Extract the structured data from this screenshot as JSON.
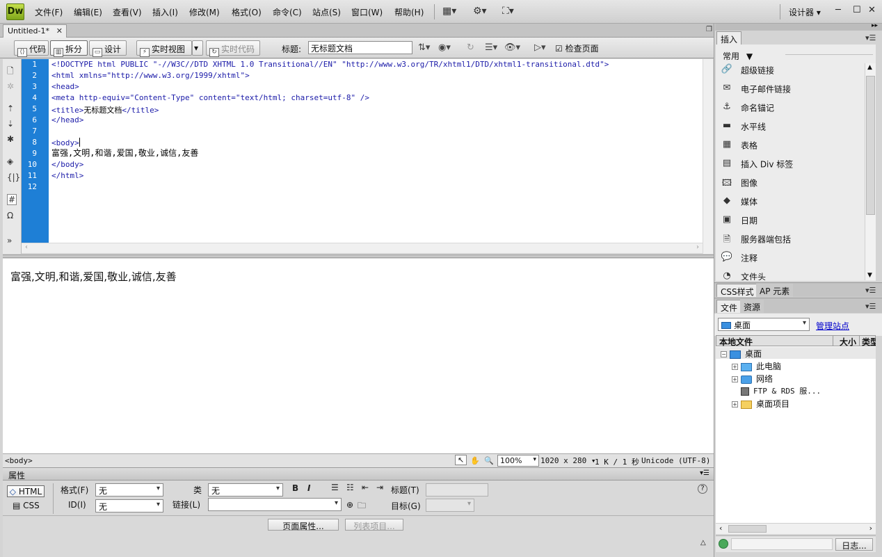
{
  "app": {
    "logo": "Dw",
    "menus": [
      "文件(F)",
      "编辑(E)",
      "查看(V)",
      "插入(I)",
      "修改(M)",
      "格式(O)",
      "命令(C)",
      "站点(S)",
      "窗口(W)",
      "帮助(H)"
    ],
    "workspace": "设计器"
  },
  "document": {
    "tab_name": "Untitled-1*",
    "toolbar": {
      "code": "代码",
      "split": "拆分",
      "design": "设计",
      "live_view": "实时视图",
      "live_code": "实时代码",
      "title_label": "标题:",
      "title_value": "无标题文档",
      "check_page": "检查页面"
    }
  },
  "code": {
    "line_numbers": [
      "1",
      "2",
      "3",
      "4",
      "5",
      "6",
      "7",
      "8",
      "9",
      "10",
      "11",
      "12"
    ],
    "lines": [
      "<!DOCTYPE html PUBLIC \"-//W3C//DTD XHTML 1.0 Transitional//EN\" \"http://www.w3.org/TR/xhtml1/DTD/xhtml1-transitional.dtd\">",
      "<html xmlns=\"http://www.w3.org/1999/xhtml\">",
      "<head>",
      "<meta http-equiv=\"Content-Type\" content=\"text/html; charset=utf-8\" />",
      "<title>",
      "</head>",
      "",
      "<body>",
      "",
      "</body>",
      "</html>",
      ""
    ],
    "title_text": "无标题文档",
    "title_close": "</title>",
    "body_text": "富强,文明,和谐,爱国,敬业,诚信,友善"
  },
  "design": {
    "text": "富强,文明,和谐,爱国,敬业,诚信,友善"
  },
  "status": {
    "tag": "<body>",
    "zoom": "100%",
    "dimensions": "1020 x 280",
    "size_info": "1 K / 1 秒",
    "encoding": "Unicode (UTF-8)"
  },
  "properties": {
    "title": "属性",
    "html_btn": "HTML",
    "css_btn": "CSS",
    "format_label": "格式(F)",
    "format_value": "无",
    "class_label": "类",
    "class_value": "无",
    "id_label": "ID(I)",
    "id_value": "无",
    "link_label": "链接(L)",
    "link_value": "",
    "title_label": "标题(T)",
    "target_label": "目标(G)",
    "bold": "B",
    "italic": "I",
    "page_props_btn": "页面属性...",
    "list_item_btn": "列表项目...",
    "help": "?"
  },
  "insert_panel": {
    "tab": "插入",
    "category": "常用",
    "items": [
      "超级链接",
      "电子邮件链接",
      "命名锚记",
      "水平线",
      "表格",
      "插入 Div 标签",
      "图像",
      "媒体",
      "日期",
      "服务器端包括",
      "注释",
      "文件头"
    ]
  },
  "css_panel": {
    "tabs": [
      "CSS样式",
      "AP 元素"
    ]
  },
  "files_panel": {
    "tabs": [
      "文件",
      "资源"
    ],
    "location": "桌面",
    "manage_sites": "管理站点",
    "columns": [
      "本地文件",
      "大小",
      "类型"
    ],
    "root": "桌面",
    "items": [
      "此电脑",
      "网络",
      "FTP & RDS 服...",
      "桌面项目"
    ],
    "log_btn": "日志..."
  },
  "colors": {
    "gutter": "#1e7fd6",
    "tag_color": "#1a1aa8",
    "link_color": "#0000cc"
  }
}
